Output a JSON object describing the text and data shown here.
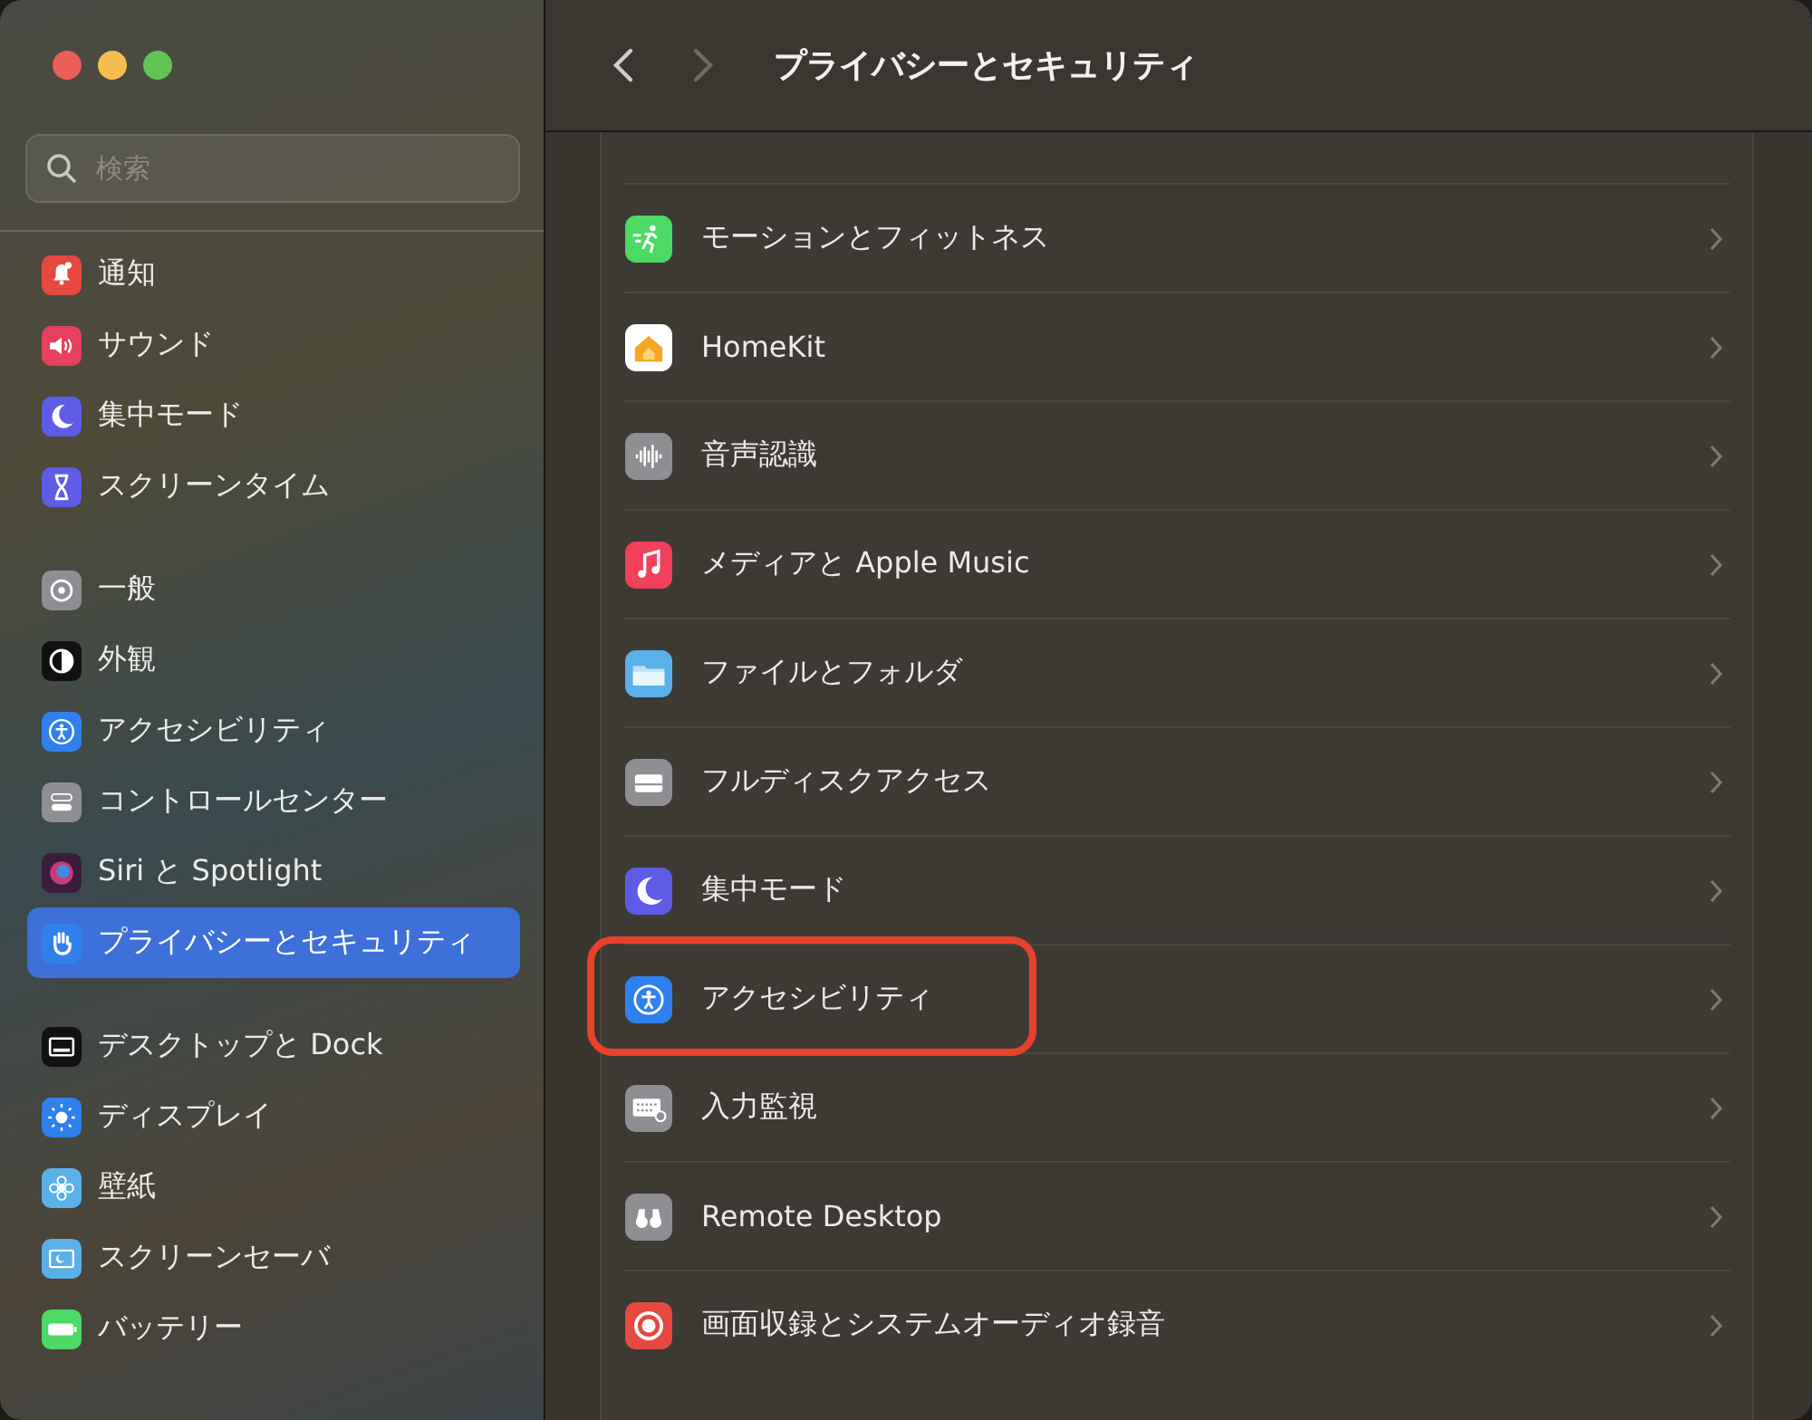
{
  "sidebar": {
    "search": {
      "placeholder": "検索"
    },
    "groups": [
      {
        "items": [
          {
            "label": "通知",
            "selected": false
          },
          {
            "label": "サウンド",
            "selected": false
          },
          {
            "label": "集中モード",
            "selected": false
          },
          {
            "label": "スクリーンタイム",
            "selected": false
          }
        ]
      },
      {
        "items": [
          {
            "label": "一般",
            "selected": false
          },
          {
            "label": "外観",
            "selected": false
          },
          {
            "label": "アクセシビリティ",
            "selected": false
          },
          {
            "label": "コントロールセンター",
            "selected": false
          },
          {
            "label": "Siri と Spotlight",
            "selected": false
          },
          {
            "label": "プライバシーとセキュリティ",
            "selected": true
          }
        ]
      },
      {
        "items": [
          {
            "label": "デスクトップと Dock",
            "selected": false
          },
          {
            "label": "ディスプレイ",
            "selected": false
          },
          {
            "label": "壁紙",
            "selected": false
          },
          {
            "label": "スクリーンセーバ",
            "selected": false
          },
          {
            "label": "バッテリー",
            "selected": false
          }
        ]
      }
    ]
  },
  "toolbar": {
    "back_enabled": true,
    "forward_enabled": false,
    "title": "プライバシーとセキュリティ"
  },
  "rows": [
    {
      "label": "モーションとフィットネス",
      "highlighted": false
    },
    {
      "label": "HomeKit",
      "highlighted": false
    },
    {
      "label": "音声認識",
      "highlighted": false
    },
    {
      "label": "メディアと Apple Music",
      "highlighted": false
    },
    {
      "label": "ファイルとフォルダ",
      "highlighted": false
    },
    {
      "label": "フルディスクアクセス",
      "highlighted": false
    },
    {
      "label": "集中モード",
      "highlighted": false
    },
    {
      "label": "アクセシビリティ",
      "highlighted": true
    },
    {
      "label": "入力監視",
      "highlighted": false
    },
    {
      "label": "Remote Desktop",
      "highlighted": false
    },
    {
      "label": "画面収録とシステムオーディオ録音",
      "highlighted": false
    }
  ]
}
